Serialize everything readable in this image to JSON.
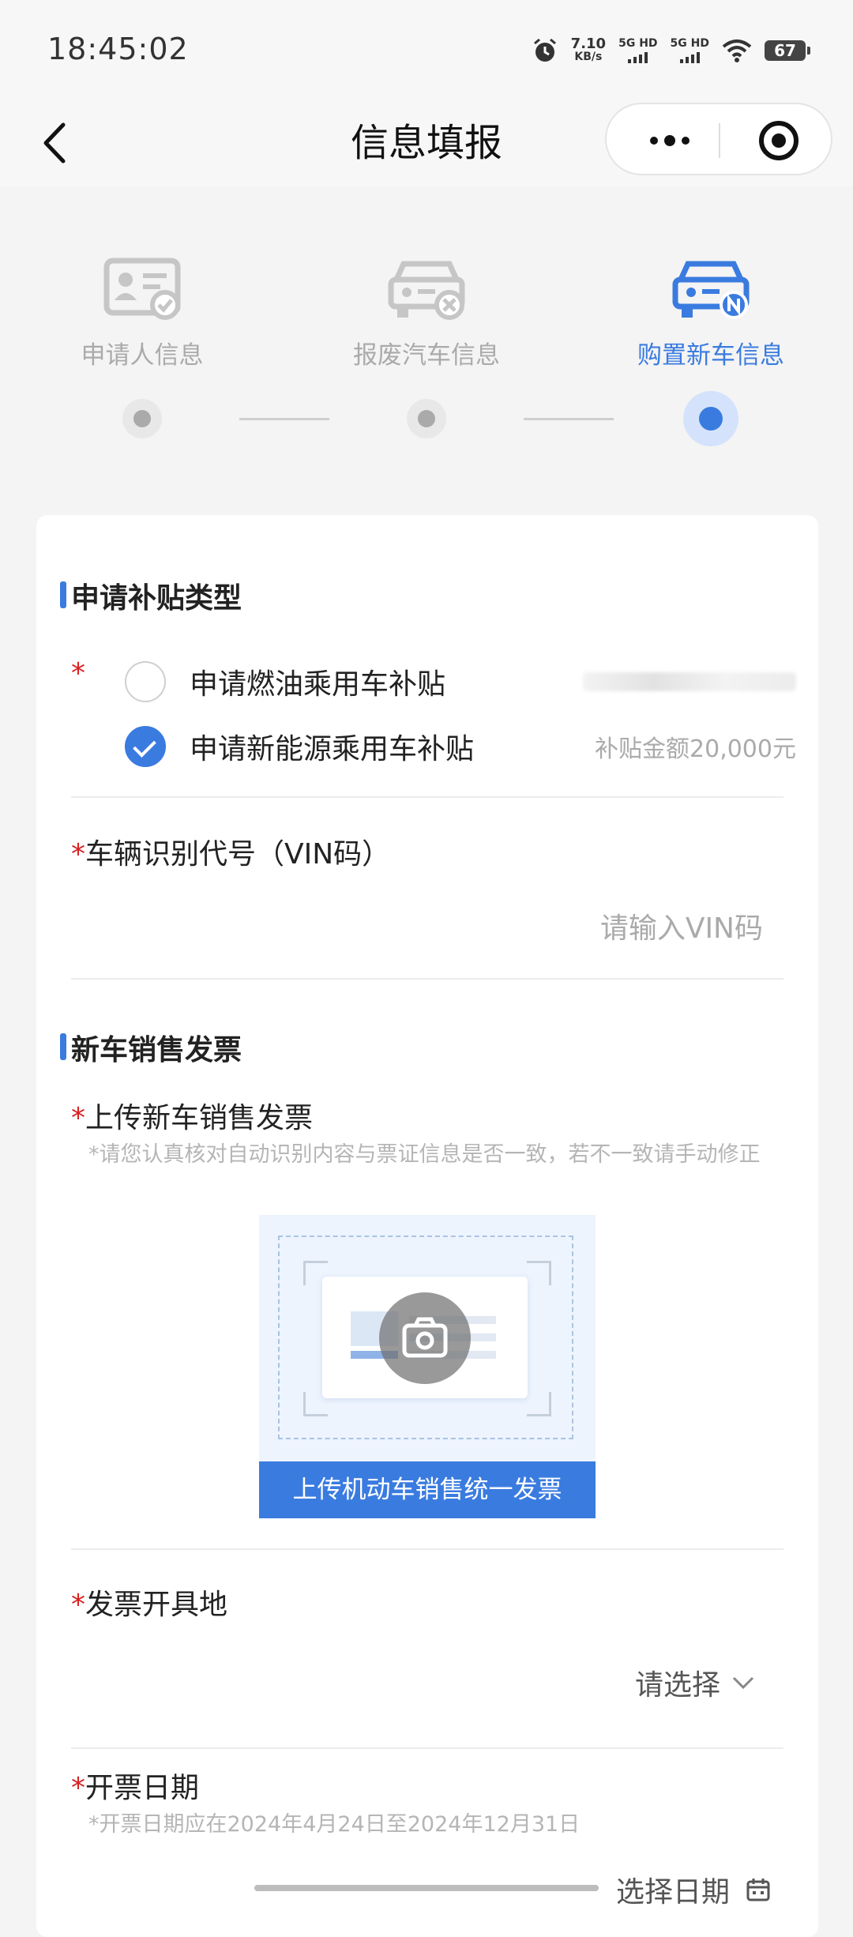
{
  "status_bar": {
    "time": "18:45:02",
    "speed_value": "7.10",
    "speed_unit": "KB/s",
    "sim1": "5G HD",
    "sim2": "5G HD",
    "battery": "67"
  },
  "nav": {
    "title": "信息填报"
  },
  "steps": [
    {
      "label": "申请人信息",
      "icon": "id-card-check-icon",
      "active": false
    },
    {
      "label": "报废汽车信息",
      "icon": "car-x-icon",
      "active": false
    },
    {
      "label": "购置新车信息",
      "icon": "car-n-icon",
      "active": true
    }
  ],
  "subsidy": {
    "section_title": "申请补贴类型",
    "required_mark": "*",
    "options": [
      {
        "label": "申请燃油乘用车补贴",
        "checked": false,
        "amount": ""
      },
      {
        "label": "申请新能源乘用车补贴",
        "checked": true,
        "amount": "补贴金额20,000元"
      }
    ]
  },
  "vin": {
    "required_mark": "*",
    "label": "车辆识别代号（VIN码）",
    "placeholder": "请输入VIN码"
  },
  "invoice": {
    "section_title": "新车销售发票",
    "upload_label": "上传新车销售发票",
    "hint": "*请您认真核对自动识别内容与票证信息是否一致，若不一致请手动修正",
    "upload_button": "上传机动车销售统一发票",
    "place_label": "发票开具地",
    "place_placeholder": "请选择",
    "date_label": "开票日期",
    "date_hint": "*开票日期应在2024年4月24日至2024年12月31日",
    "date_placeholder": "选择日期"
  },
  "colors": {
    "accent": "#3a7be0",
    "required": "#d92020",
    "muted": "#aaaaaa"
  }
}
